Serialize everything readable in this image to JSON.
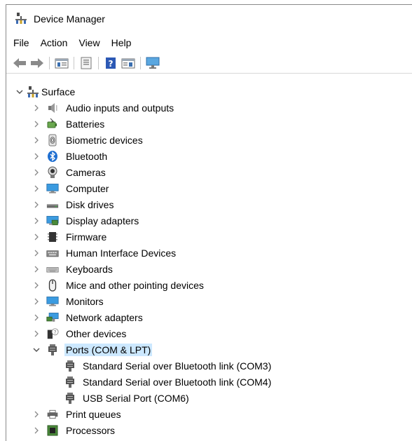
{
  "window": {
    "title": "Device Manager"
  },
  "menu": [
    "File",
    "Action",
    "View",
    "Help"
  ],
  "toolbar": [
    "back-icon",
    "forward-icon",
    "properties-icon",
    "update-icon",
    "help-icon",
    "show-hidden-icon",
    "monitor-icon"
  ],
  "tree": {
    "root": "Surface",
    "categories": [
      "Audio inputs and outputs",
      "Batteries",
      "Biometric devices",
      "Bluetooth",
      "Cameras",
      "Computer",
      "Disk drives",
      "Display adapters",
      "Firmware",
      "Human Interface Devices",
      "Keyboards",
      "Mice and other pointing devices",
      "Monitors",
      "Network adapters",
      "Other devices",
      "Ports (COM & LPT)",
      "Print queues",
      "Processors"
    ],
    "ports_children": [
      "Standard Serial over Bluetooth link (COM3)",
      "Standard Serial over Bluetooth link (COM4)",
      "USB Serial Port (COM6)"
    ]
  }
}
